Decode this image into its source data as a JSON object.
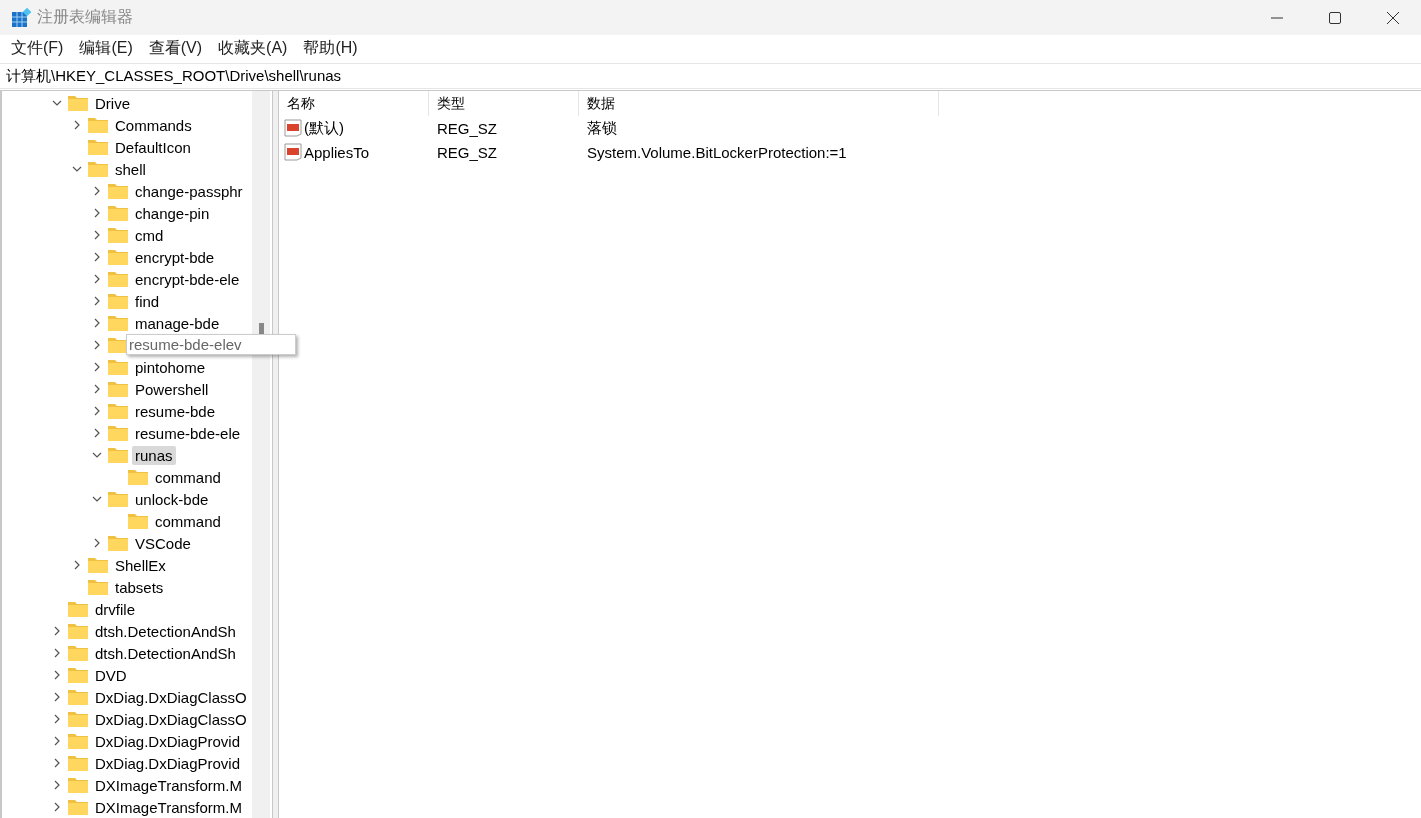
{
  "window": {
    "title": "注册表编辑器"
  },
  "menu": [
    "文件(F)",
    "编辑(E)",
    "查看(V)",
    "收藏夹(A)",
    "帮助(H)"
  ],
  "address": "计算机\\HKEY_CLASSES_ROOT\\Drive\\shell\\runas",
  "tree": [
    {
      "label": "Drive",
      "expandable": true,
      "expanded": true,
      "selected": false,
      "children": [
        {
          "label": "Commands",
          "expandable": true,
          "expanded": false,
          "selected": false
        },
        {
          "label": "DefaultIcon",
          "expandable": false,
          "selected": false
        },
        {
          "label": "shell",
          "expandable": true,
          "expanded": true,
          "selected": false,
          "children": [
            {
              "label": "change-passphr",
              "expandable": true,
              "expanded": false,
              "selected": false
            },
            {
              "label": "change-pin",
              "expandable": true,
              "expanded": false,
              "selected": false
            },
            {
              "label": "cmd",
              "expandable": true,
              "expanded": false,
              "selected": false
            },
            {
              "label": "encrypt-bde",
              "expandable": true,
              "expanded": false,
              "selected": false
            },
            {
              "label": "encrypt-bde-ele",
              "expandable": true,
              "expanded": false,
              "selected": false
            },
            {
              "label": "find",
              "expandable": true,
              "expanded": false,
              "selected": false
            },
            {
              "label": "manage-bde",
              "expandable": true,
              "expanded": false,
              "selected": false
            },
            {
              "label": "resume-bde-elev",
              "expandable": true,
              "expanded": false,
              "selected": false,
              "tooltip": true
            },
            {
              "label": "pintohome",
              "expandable": true,
              "expanded": false,
              "selected": false
            },
            {
              "label": "Powershell",
              "expandable": true,
              "expanded": false,
              "selected": false
            },
            {
              "label": "resume-bde",
              "expandable": true,
              "expanded": false,
              "selected": false
            },
            {
              "label": "resume-bde-ele",
              "expandable": true,
              "expanded": false,
              "selected": false
            },
            {
              "label": "runas",
              "expandable": true,
              "expanded": true,
              "selected": true,
              "children": [
                {
                  "label": "command",
                  "expandable": false,
                  "selected": false
                }
              ]
            },
            {
              "label": "unlock-bde",
              "expandable": true,
              "expanded": true,
              "selected": false,
              "children": [
                {
                  "label": "command",
                  "expandable": false,
                  "selected": false
                }
              ]
            },
            {
              "label": "VSCode",
              "expandable": true,
              "expanded": false,
              "selected": false
            }
          ]
        },
        {
          "label": "ShellEx",
          "expandable": true,
          "expanded": false,
          "selected": false
        },
        {
          "label": "tabsets",
          "expandable": false,
          "selected": false
        }
      ]
    },
    {
      "label": "drvfile",
      "expandable": false,
      "selected": false
    },
    {
      "label": "dtsh.DetectionAndSh",
      "expandable": true,
      "expanded": false,
      "selected": false
    },
    {
      "label": "dtsh.DetectionAndSh",
      "expandable": true,
      "expanded": false,
      "selected": false
    },
    {
      "label": "DVD",
      "expandable": true,
      "expanded": false,
      "selected": false
    },
    {
      "label": "DxDiag.DxDiagClassO",
      "expandable": true,
      "expanded": false,
      "selected": false
    },
    {
      "label": "DxDiag.DxDiagClassO",
      "expandable": true,
      "expanded": false,
      "selected": false
    },
    {
      "label": "DxDiag.DxDiagProvid",
      "expandable": true,
      "expanded": false,
      "selected": false
    },
    {
      "label": "DxDiag.DxDiagProvid",
      "expandable": true,
      "expanded": false,
      "selected": false
    },
    {
      "label": "DXImageTransform.M",
      "expandable": true,
      "expanded": false,
      "selected": false
    },
    {
      "label": "DXImageTransform.M",
      "expandable": true,
      "expanded": false,
      "selected": false
    }
  ],
  "table": {
    "columns": [
      "名称",
      "类型",
      "数据"
    ],
    "rows": [
      {
        "name": "(默认)",
        "type": "REG_SZ",
        "data": "落锁"
      },
      {
        "name": "AppliesTo",
        "type": "REG_SZ",
        "data": "System.Volume.BitLockerProtection:=1"
      }
    ]
  }
}
